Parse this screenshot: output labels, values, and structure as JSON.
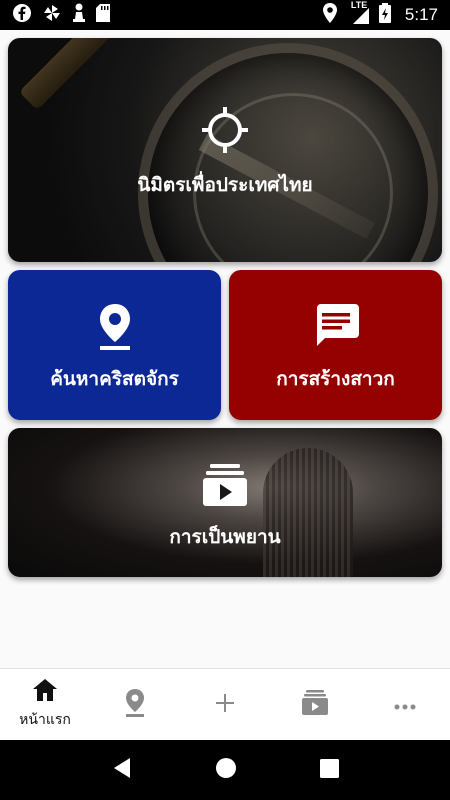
{
  "status_bar": {
    "time": "5:17",
    "network": "LTE",
    "left_icons": [
      "facebook-icon",
      "pinwheel-icon",
      "chess-pawn-icon",
      "sd-card-icon"
    ],
    "right_icons": [
      "location-icon",
      "signal-icon",
      "battery-icon"
    ]
  },
  "cards": {
    "hero": {
      "label": "นิมิตรเพื่อประเทศไทย",
      "icon": "target-icon"
    },
    "find_church": {
      "label": "ค้นหาคริสตจักร",
      "icon": "map-pin-icon",
      "color": "#0b2895"
    },
    "disciple": {
      "label": "การสร้างสาวก",
      "icon": "message-icon",
      "color": "#950101"
    },
    "witness": {
      "label": "การเป็นพยาน",
      "icon": "video-library-icon"
    }
  },
  "bottom_nav": {
    "items": [
      {
        "label": "หน้าแรก",
        "icon": "home-icon",
        "active": true
      },
      {
        "label": "",
        "icon": "map-pin-icon",
        "active": false
      },
      {
        "label": "",
        "icon": "plus-icon",
        "active": false
      },
      {
        "label": "",
        "icon": "video-library-icon",
        "active": false
      },
      {
        "label": "",
        "icon": "more-horizontal-icon",
        "active": false
      }
    ]
  },
  "system_nav": {
    "icons": [
      "back-icon",
      "home-circle-icon",
      "recents-icon"
    ]
  }
}
